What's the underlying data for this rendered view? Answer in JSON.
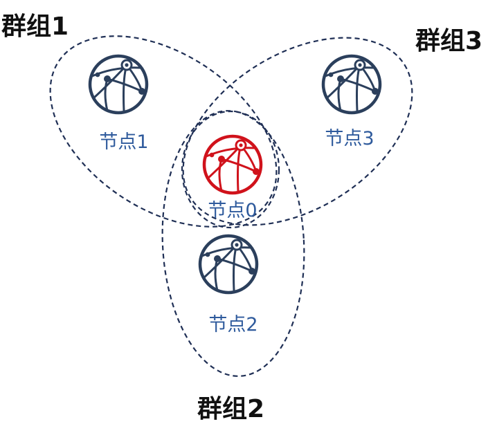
{
  "colors": {
    "outline": "#1f2f55",
    "node": "#2b3f5c",
    "node_center": "#d0121b",
    "node_label": "#2e5a9c",
    "group_label": "#111111"
  },
  "groups": [
    {
      "label": "群组1"
    },
    {
      "label": "群组3"
    },
    {
      "label": "群组2"
    }
  ],
  "nodes": [
    {
      "label": "节点1",
      "icon": "globe-network-icon"
    },
    {
      "label": "节点3",
      "icon": "globe-network-icon"
    },
    {
      "label": "节点0",
      "icon": "globe-network-icon",
      "highlighted": true
    },
    {
      "label": "节点2",
      "icon": "globe-network-icon"
    }
  ]
}
